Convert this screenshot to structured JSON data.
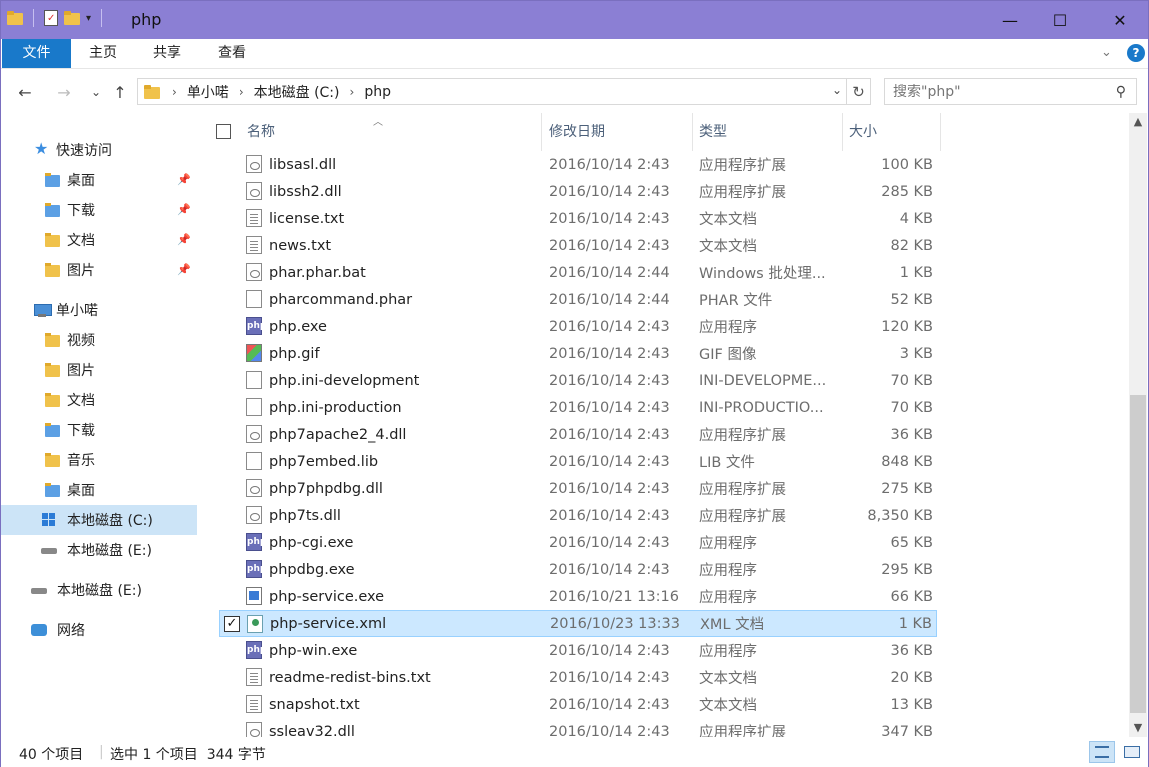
{
  "window": {
    "title": "php",
    "minimize": "—",
    "maximize": "☐",
    "close": "✕"
  },
  "ribbon": {
    "tabs": [
      "文件",
      "主页",
      "共享",
      "查看"
    ]
  },
  "nav": {
    "back": "←",
    "forward": "→",
    "recent": "⌄",
    "up": "↑",
    "breadcrumb": [
      "单小喏",
      "本地磁盘 (C:)",
      "php"
    ],
    "search_placeholder": "搜索\"php\""
  },
  "sidebar": {
    "items": [
      {
        "label": "快速访问",
        "icon": "star-icon"
      },
      {
        "label": "桌面",
        "icon": "folder-icon",
        "pinned": true
      },
      {
        "label": "下载",
        "icon": "download-folder-icon",
        "pinned": true
      },
      {
        "label": "文档",
        "icon": "documents-folder-icon",
        "pinned": true
      },
      {
        "label": "图片",
        "icon": "pictures-folder-icon",
        "pinned": true
      },
      {
        "label": "单小喏",
        "icon": "computer-icon"
      },
      {
        "label": "视频",
        "icon": "videos-folder-icon"
      },
      {
        "label": "图片",
        "icon": "pictures-folder-icon"
      },
      {
        "label": "文档",
        "icon": "documents-folder-icon"
      },
      {
        "label": "下载",
        "icon": "download-folder-icon"
      },
      {
        "label": "音乐",
        "icon": "music-folder-icon"
      },
      {
        "label": "桌面",
        "icon": "folder-icon"
      },
      {
        "label": "本地磁盘 (C:)",
        "icon": "windows-drive-icon",
        "selected": true
      },
      {
        "label": "本地磁盘 (E:)",
        "icon": "drive-icon"
      },
      {
        "label": "本地磁盘 (E:)",
        "icon": "drive-icon"
      },
      {
        "label": "网络",
        "icon": "network-icon"
      }
    ]
  },
  "columns": {
    "name": "名称",
    "date": "修改日期",
    "type": "类型",
    "size": "大小"
  },
  "files": [
    {
      "name": "libsasl.dll",
      "date": "2016/10/14 2:43",
      "type": "应用程序扩展",
      "size": "100 KB",
      "icon": "dll"
    },
    {
      "name": "libssh2.dll",
      "date": "2016/10/14 2:43",
      "type": "应用程序扩展",
      "size": "285 KB",
      "icon": "dll"
    },
    {
      "name": "license.txt",
      "date": "2016/10/14 2:43",
      "type": "文本文档",
      "size": "4 KB",
      "icon": "txt"
    },
    {
      "name": "news.txt",
      "date": "2016/10/14 2:43",
      "type": "文本文档",
      "size": "82 KB",
      "icon": "txt"
    },
    {
      "name": "phar.phar.bat",
      "date": "2016/10/14 2:44",
      "type": "Windows 批处理...",
      "size": "1 KB",
      "icon": "dll"
    },
    {
      "name": "pharcommand.phar",
      "date": "2016/10/14 2:44",
      "type": "PHAR 文件",
      "size": "52 KB",
      "icon": "blank"
    },
    {
      "name": "php.exe",
      "date": "2016/10/14 2:43",
      "type": "应用程序",
      "size": "120 KB",
      "icon": "php"
    },
    {
      "name": "php.gif",
      "date": "2016/10/14 2:43",
      "type": "GIF 图像",
      "size": "3 KB",
      "icon": "gif"
    },
    {
      "name": "php.ini-development",
      "date": "2016/10/14 2:43",
      "type": "INI-DEVELOPME...",
      "size": "70 KB",
      "icon": "blank"
    },
    {
      "name": "php.ini-production",
      "date": "2016/10/14 2:43",
      "type": "INI-PRODUCTIO...",
      "size": "70 KB",
      "icon": "blank"
    },
    {
      "name": "php7apache2_4.dll",
      "date": "2016/10/14 2:43",
      "type": "应用程序扩展",
      "size": "36 KB",
      "icon": "dll"
    },
    {
      "name": "php7embed.lib",
      "date": "2016/10/14 2:43",
      "type": "LIB 文件",
      "size": "848 KB",
      "icon": "blank"
    },
    {
      "name": "php7phpdbg.dll",
      "date": "2016/10/14 2:43",
      "type": "应用程序扩展",
      "size": "275 KB",
      "icon": "dll"
    },
    {
      "name": "php7ts.dll",
      "date": "2016/10/14 2:43",
      "type": "应用程序扩展",
      "size": "8,350 KB",
      "icon": "dll"
    },
    {
      "name": "php-cgi.exe",
      "date": "2016/10/14 2:43",
      "type": "应用程序",
      "size": "65 KB",
      "icon": "php"
    },
    {
      "name": "phpdbg.exe",
      "date": "2016/10/14 2:43",
      "type": "应用程序",
      "size": "295 KB",
      "icon": "php"
    },
    {
      "name": "php-service.exe",
      "date": "2016/10/21 13:16",
      "type": "应用程序",
      "size": "66 KB",
      "icon": "svc"
    },
    {
      "name": "php-service.xml",
      "date": "2016/10/23 13:33",
      "type": "XML 文档",
      "size": "1 KB",
      "icon": "xml",
      "selected": true
    },
    {
      "name": "php-win.exe",
      "date": "2016/10/14 2:43",
      "type": "应用程序",
      "size": "36 KB",
      "icon": "php"
    },
    {
      "name": "readme-redist-bins.txt",
      "date": "2016/10/14 2:43",
      "type": "文本文档",
      "size": "20 KB",
      "icon": "txt"
    },
    {
      "name": "snapshot.txt",
      "date": "2016/10/14 2:43",
      "type": "文本文档",
      "size": "13 KB",
      "icon": "txt"
    },
    {
      "name": "ssleav32.dll",
      "date": "2016/10/14 2:43",
      "type": "应用程序扩展",
      "size": "347 KB",
      "icon": "dll"
    }
  ],
  "php_icon_text": "php",
  "status": {
    "count": "40 个项目",
    "selection": "选中 1 个项目  344 字节"
  },
  "colors": {
    "titlebar": "#8b7fd4",
    "file_tab": "#1979ca",
    "selection": "#cce8ff"
  }
}
